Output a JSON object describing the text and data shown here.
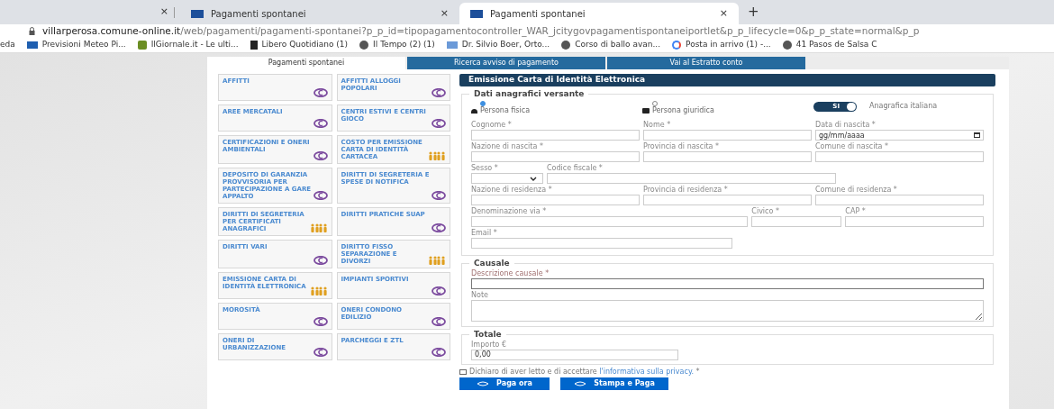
{
  "browser": {
    "tabs": [
      {
        "label": "Pagamenti spontanei",
        "selected": false,
        "close": "×"
      },
      {
        "label": "Pagamenti spontanei",
        "selected": true,
        "close": "×"
      }
    ],
    "first_tab_close": "×",
    "new_tab": "+",
    "url_host": "villarperosa.comune-online.it",
    "url_path": "/web/pagamenti/pagamenti-spontanei?p_p_id=tipopagamentocontroller_WAR_jcitygovpagamentispontaneiportlet&p_p_lifecycle=0&p_p_state=normal&p_p",
    "bookmarks": [
      {
        "label": "eda",
        "kind": "none"
      },
      {
        "label": "Previsioni Meteo Pi...",
        "kind": "box"
      },
      {
        "label": "IlGiornale.it - Le ulti...",
        "kind": "g"
      },
      {
        "label": "Libero Quotidiano (1)",
        "kind": "l"
      },
      {
        "label": "Il Tempo (2) (1)",
        "kind": "globe"
      },
      {
        "label": "Dr. Silvio Boer, Orto...",
        "kind": "m"
      },
      {
        "label": "Corso di ballo avan...",
        "kind": "globe"
      },
      {
        "label": "Posta in arrivo (1) -...",
        "kind": "google"
      },
      {
        "label": "41 Pasos de Salsa C",
        "kind": "globe"
      }
    ]
  },
  "page_tabs": [
    {
      "label": "Pagamenti spontanei",
      "selected": true
    },
    {
      "label": "Ricerca avviso di pagamento",
      "selected": false
    },
    {
      "label": "Vai al Estratto conto",
      "selected": false
    }
  ],
  "tiles": [
    {
      "label": "AFFITTI",
      "kind": "euro"
    },
    {
      "label": "AFFITTI ALLOGGI POPOLARI",
      "kind": "euro"
    },
    {
      "label": "AREE MERCATALI",
      "kind": "euro"
    },
    {
      "label": "CENTRI ESTIVI E CENTRI GIOCO",
      "kind": "euro"
    },
    {
      "label": "CERTIFICAZIONI E ONERI AMBIENTALI",
      "kind": "euro"
    },
    {
      "label": "COSTO PER EMISSIONE CARTA DI IDENTITÀ CARTACEA",
      "kind": "people"
    },
    {
      "label": "DEPOSITO DI GARANZIA PROVVISORIA PER PARTECIPAZIONE A GARE APPALTO",
      "kind": "euro"
    },
    {
      "label": "DIRITTI DI SEGRETERIA E SPESE DI NOTIFICA",
      "kind": "euro"
    },
    {
      "label": "DIRITTI DI SEGRETERIA PER CERTIFICATI ANAGRAFICI",
      "kind": "people"
    },
    {
      "label": "DIRITTI PRATICHE SUAP",
      "kind": "euro"
    },
    {
      "label": "DIRITTI VARI",
      "kind": "euro"
    },
    {
      "label": "DIRITTO FISSO SEPARAZIONE E DIVORZI",
      "kind": "people"
    },
    {
      "label": "EMISSIONE CARTA DI IDENTITÀ ELETTRONICA",
      "kind": "people"
    },
    {
      "label": "IMPIANTI SPORTIVI",
      "kind": "euro"
    },
    {
      "label": "MOROSITÀ",
      "kind": "euro"
    },
    {
      "label": "ONERI CONDONO EDILIZIO",
      "kind": "euro"
    },
    {
      "label": "ONERI DI URBANIZZAZIONE",
      "kind": "euro"
    },
    {
      "label": "PARCHEGGI E ZTL",
      "kind": "euro"
    }
  ],
  "form": {
    "title": "Emissione Carta di Identità Elettronica",
    "anagrafica": {
      "legend": "Dati anagrafici versante",
      "types": [
        {
          "label": "Persona fisica",
          "kind": "person",
          "selected": true
        },
        {
          "label": "Persona giuridica",
          "kind": "briefcase",
          "selected": false
        }
      ],
      "toggle": {
        "label": "SI",
        "on": true,
        "caption": "Anagrafica italiana"
      },
      "rows": [
        [
          {
            "label": "Cognome *"
          },
          {
            "label": "Nome *"
          },
          {
            "label": "Data di nascita *",
            "placeholder": "gg/mm/aaaa",
            "kind": "date"
          }
        ],
        [
          {
            "label": "Nazione di nascita *"
          },
          {
            "label": "Provincia di nascita *"
          },
          {
            "label": "Comune di nascita *"
          }
        ],
        [
          {
            "label": "Sesso *",
            "kind": "select"
          },
          {
            "label": "Codice fiscale *",
            "kind": "wide"
          }
        ],
        [
          {
            "label": "Nazione di residenza *"
          },
          {
            "label": "Provincia di residenza *"
          },
          {
            "label": "Comune di residenza *"
          }
        ],
        [
          {
            "label": "Denominazione via *",
            "kind": "wide"
          },
          {
            "label": "Civico *",
            "kind": "small"
          },
          {
            "label": "CAP *"
          }
        ],
        [
          {
            "label": "Email *",
            "kind": "half"
          }
        ]
      ]
    },
    "causale": {
      "legend": "Causale",
      "description_label": "Descrizione causale *",
      "note_label": "Note"
    },
    "totale": {
      "legend": "Totale",
      "amount_label": "Importo €",
      "amount": "0,00"
    },
    "privacy": {
      "checked": false,
      "text": "Dichiaro di aver letto e di accettare ",
      "link": "l'informativa sulla privacy.",
      "suffix": " *"
    },
    "buttons": [
      "Paga ora",
      "Stampa e Paga"
    ]
  }
}
